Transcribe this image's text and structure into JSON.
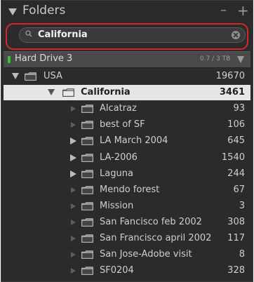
{
  "panel": {
    "title": "Folders",
    "minus_label": "–",
    "plus_label": "+"
  },
  "search": {
    "value": "California",
    "icon": "search-icon",
    "clear_icon": "clear-icon"
  },
  "volume": {
    "name": "Hard Drive 3",
    "size": "0.7 / 3 TB",
    "status_color": "#37c22f"
  },
  "tree": [
    {
      "label": "USA",
      "count": "19670",
      "level": 0,
      "disclosure": "open",
      "selected": false
    },
    {
      "label": "California",
      "count": "3461",
      "level": 1,
      "disclosure": "open",
      "selected": true
    },
    {
      "label": "Alcatraz",
      "count": "93",
      "level": 2,
      "disclosure": "none",
      "selected": false
    },
    {
      "label": "best of SF",
      "count": "106",
      "level": 2,
      "disclosure": "none",
      "selected": false
    },
    {
      "label": "LA March 2004",
      "count": "645",
      "level": 2,
      "disclosure": "closed",
      "selected": false
    },
    {
      "label": "LA-2006",
      "count": "1540",
      "level": 2,
      "disclosure": "closed",
      "selected": false
    },
    {
      "label": "Laguna",
      "count": "244",
      "level": 2,
      "disclosure": "closed",
      "selected": false
    },
    {
      "label": "Mendo forest",
      "count": "67",
      "level": 2,
      "disclosure": "none",
      "selected": false
    },
    {
      "label": "Mission",
      "count": "3",
      "level": 2,
      "disclosure": "none",
      "selected": false
    },
    {
      "label": "San Fancisco feb 2002",
      "count": "308",
      "level": 2,
      "disclosure": "none",
      "selected": false
    },
    {
      "label": "San Francisco april 2002",
      "count": "117",
      "level": 2,
      "disclosure": "none",
      "selected": false
    },
    {
      "label": "San Jose-Adobe visit",
      "count": "8",
      "level": 2,
      "disclosure": "none",
      "selected": false
    },
    {
      "label": "SF0204",
      "count": "328",
      "level": 2,
      "disclosure": "none",
      "selected": false
    }
  ],
  "colors": {
    "panel_bg": "#2b2b2b",
    "highlight_frame": "#d8252b",
    "selected_row_bg": "#e6e6e6"
  }
}
